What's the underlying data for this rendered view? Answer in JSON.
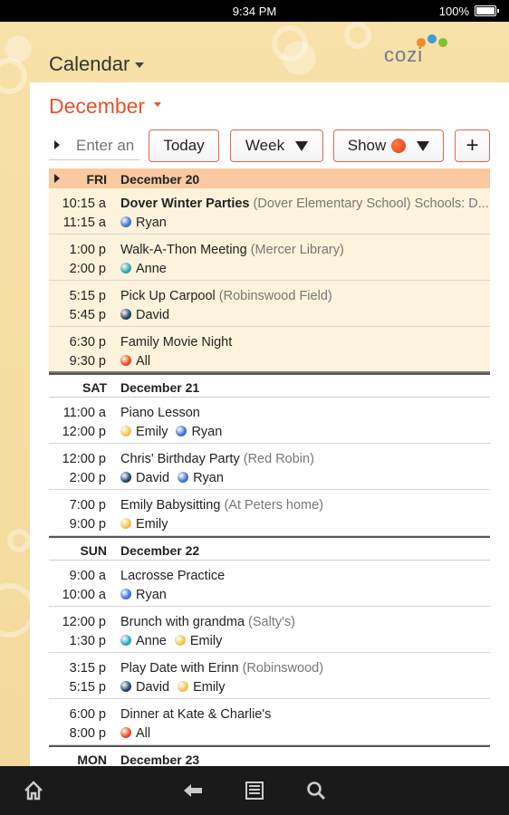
{
  "status": {
    "time": "9:34 PM",
    "battery": "100%"
  },
  "header": {
    "title": "Calendar",
    "logo_text": "cozi"
  },
  "month": "December",
  "search": {
    "placeholder": "Enter an"
  },
  "toolbar": {
    "today": "Today",
    "week": "Week",
    "show": "Show",
    "add": "+"
  },
  "days": [
    {
      "name": "FRI",
      "date": "December 20",
      "today": true,
      "events": [
        {
          "start": "10:15 a",
          "end": "11:15 a",
          "title": "Dover Winter Parties",
          "location": "(Dover Elementary School)  Schools:  D...",
          "bold": true,
          "people": [
            {
              "name": "Ryan",
              "color": "#3b6fd4"
            }
          ]
        },
        {
          "start": "1:00 p",
          "end": "2:00 p",
          "title": "Walk-A-Thon Meeting",
          "location": "(Mercer Library)",
          "people": [
            {
              "name": "Anne",
              "color": "#2aa3b0"
            }
          ]
        },
        {
          "start": "5:15 p",
          "end": "5:45 p",
          "title": "Pick Up Carpool",
          "location": "(Robinswood Field)",
          "people": [
            {
              "name": "David",
              "color": "#1d3f6a"
            }
          ]
        },
        {
          "start": "6:30 p",
          "end": "9:30 p",
          "title": "Family Movie Night",
          "location": "",
          "people": [
            {
              "name": "All",
              "color": "#e8461a"
            }
          ]
        }
      ]
    },
    {
      "name": "SAT",
      "date": "December 21",
      "events": [
        {
          "start": "11:00 a",
          "end": "12:00 p",
          "title": "Piano Lesson",
          "location": "",
          "people": [
            {
              "name": "Emily",
              "color": "#f3c24a"
            },
            {
              "name": "Ryan",
              "color": "#3b6fd4"
            }
          ]
        },
        {
          "start": "12:00 p",
          "end": "2:00 p",
          "title": "Chris' Birthday Party",
          "location": "(Red Robin)",
          "people": [
            {
              "name": "David",
              "color": "#1d3f6a"
            },
            {
              "name": "Ryan",
              "color": "#3b6fd4"
            }
          ]
        },
        {
          "start": "7:00 p",
          "end": "9:00 p",
          "title": "Emily Babysitting",
          "location": "(At Peters home)",
          "people": [
            {
              "name": "Emily",
              "color": "#f3c24a"
            }
          ]
        }
      ]
    },
    {
      "name": "SUN",
      "date": "December 22",
      "events": [
        {
          "start": "9:00 a",
          "end": "10:00 a",
          "title": "Lacrosse Practice",
          "location": "",
          "people": [
            {
              "name": "Ryan",
              "color": "#3b6fd4"
            }
          ]
        },
        {
          "start": "12:00 p",
          "end": "1:30 p",
          "title": "Brunch with grandma",
          "location": " (Salty's)",
          "people": [
            {
              "name": "Anne",
              "color": "#2aa3b0"
            },
            {
              "name": "Emily",
              "color": "#f3c24a"
            }
          ]
        },
        {
          "start": "3:15 p",
          "end": "5:15 p",
          "title": "Play Date with Erinn",
          "location": "(Robinswood)",
          "people": [
            {
              "name": "David",
              "color": "#1d3f6a"
            },
            {
              "name": "Emily",
              "color": "#f3c24a"
            }
          ]
        },
        {
          "start": "6:00 p",
          "end": "8:00 p",
          "title": "Dinner at Kate & Charlie's",
          "location": "",
          "people": [
            {
              "name": "All",
              "color": "#e8461a"
            }
          ]
        }
      ]
    },
    {
      "name": "MON",
      "date": "December 23",
      "events": []
    }
  ],
  "nav": {
    "icons": [
      "home-icon",
      "back-icon",
      "menu-icon",
      "search-icon"
    ]
  }
}
